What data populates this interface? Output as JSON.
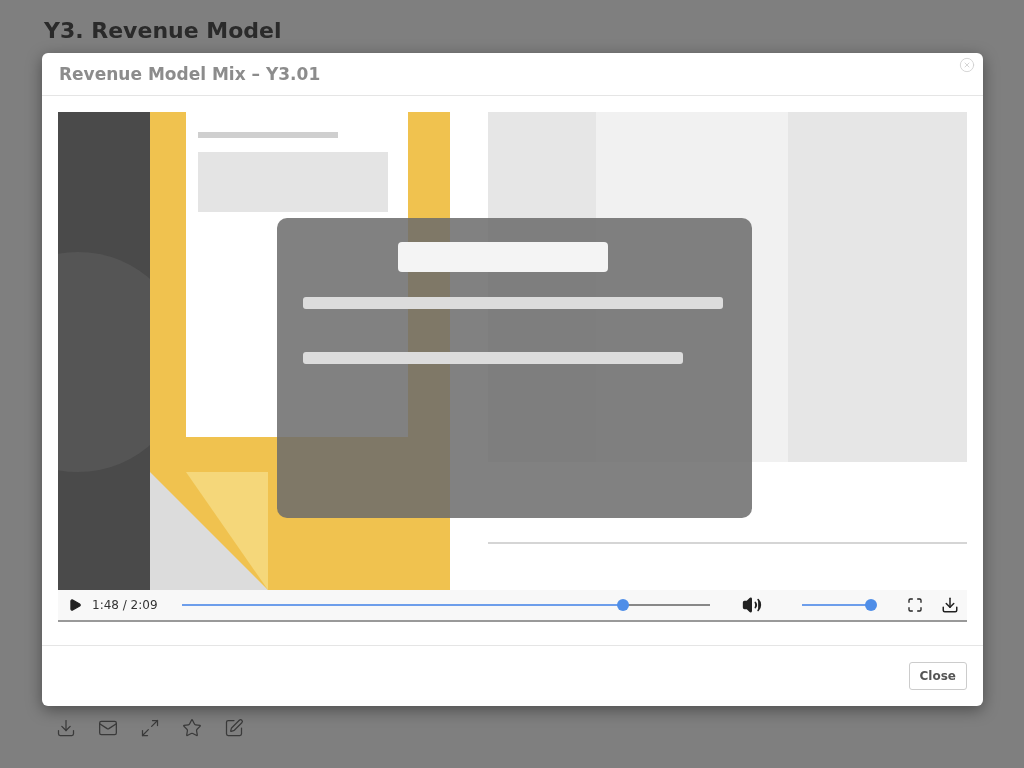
{
  "page": {
    "title": "Y3. Revenue Model"
  },
  "dialog": {
    "title": "Revenue Model Mix – Y3.01",
    "video": {
      "kind": "picture",
      "time": "1:48 / 2:09",
      "progress": {
        "level": 0.835
      },
      "volume": {
        "level": 1.0
      }
    },
    "buttons": [
      {
        "label": "Close"
      }
    ]
  },
  "toolbar": [
    {
      "kind": "download"
    },
    {
      "kind": "mail"
    },
    {
      "kind": "expand"
    },
    {
      "kind": "star"
    },
    {
      "kind": "edit"
    }
  ]
}
